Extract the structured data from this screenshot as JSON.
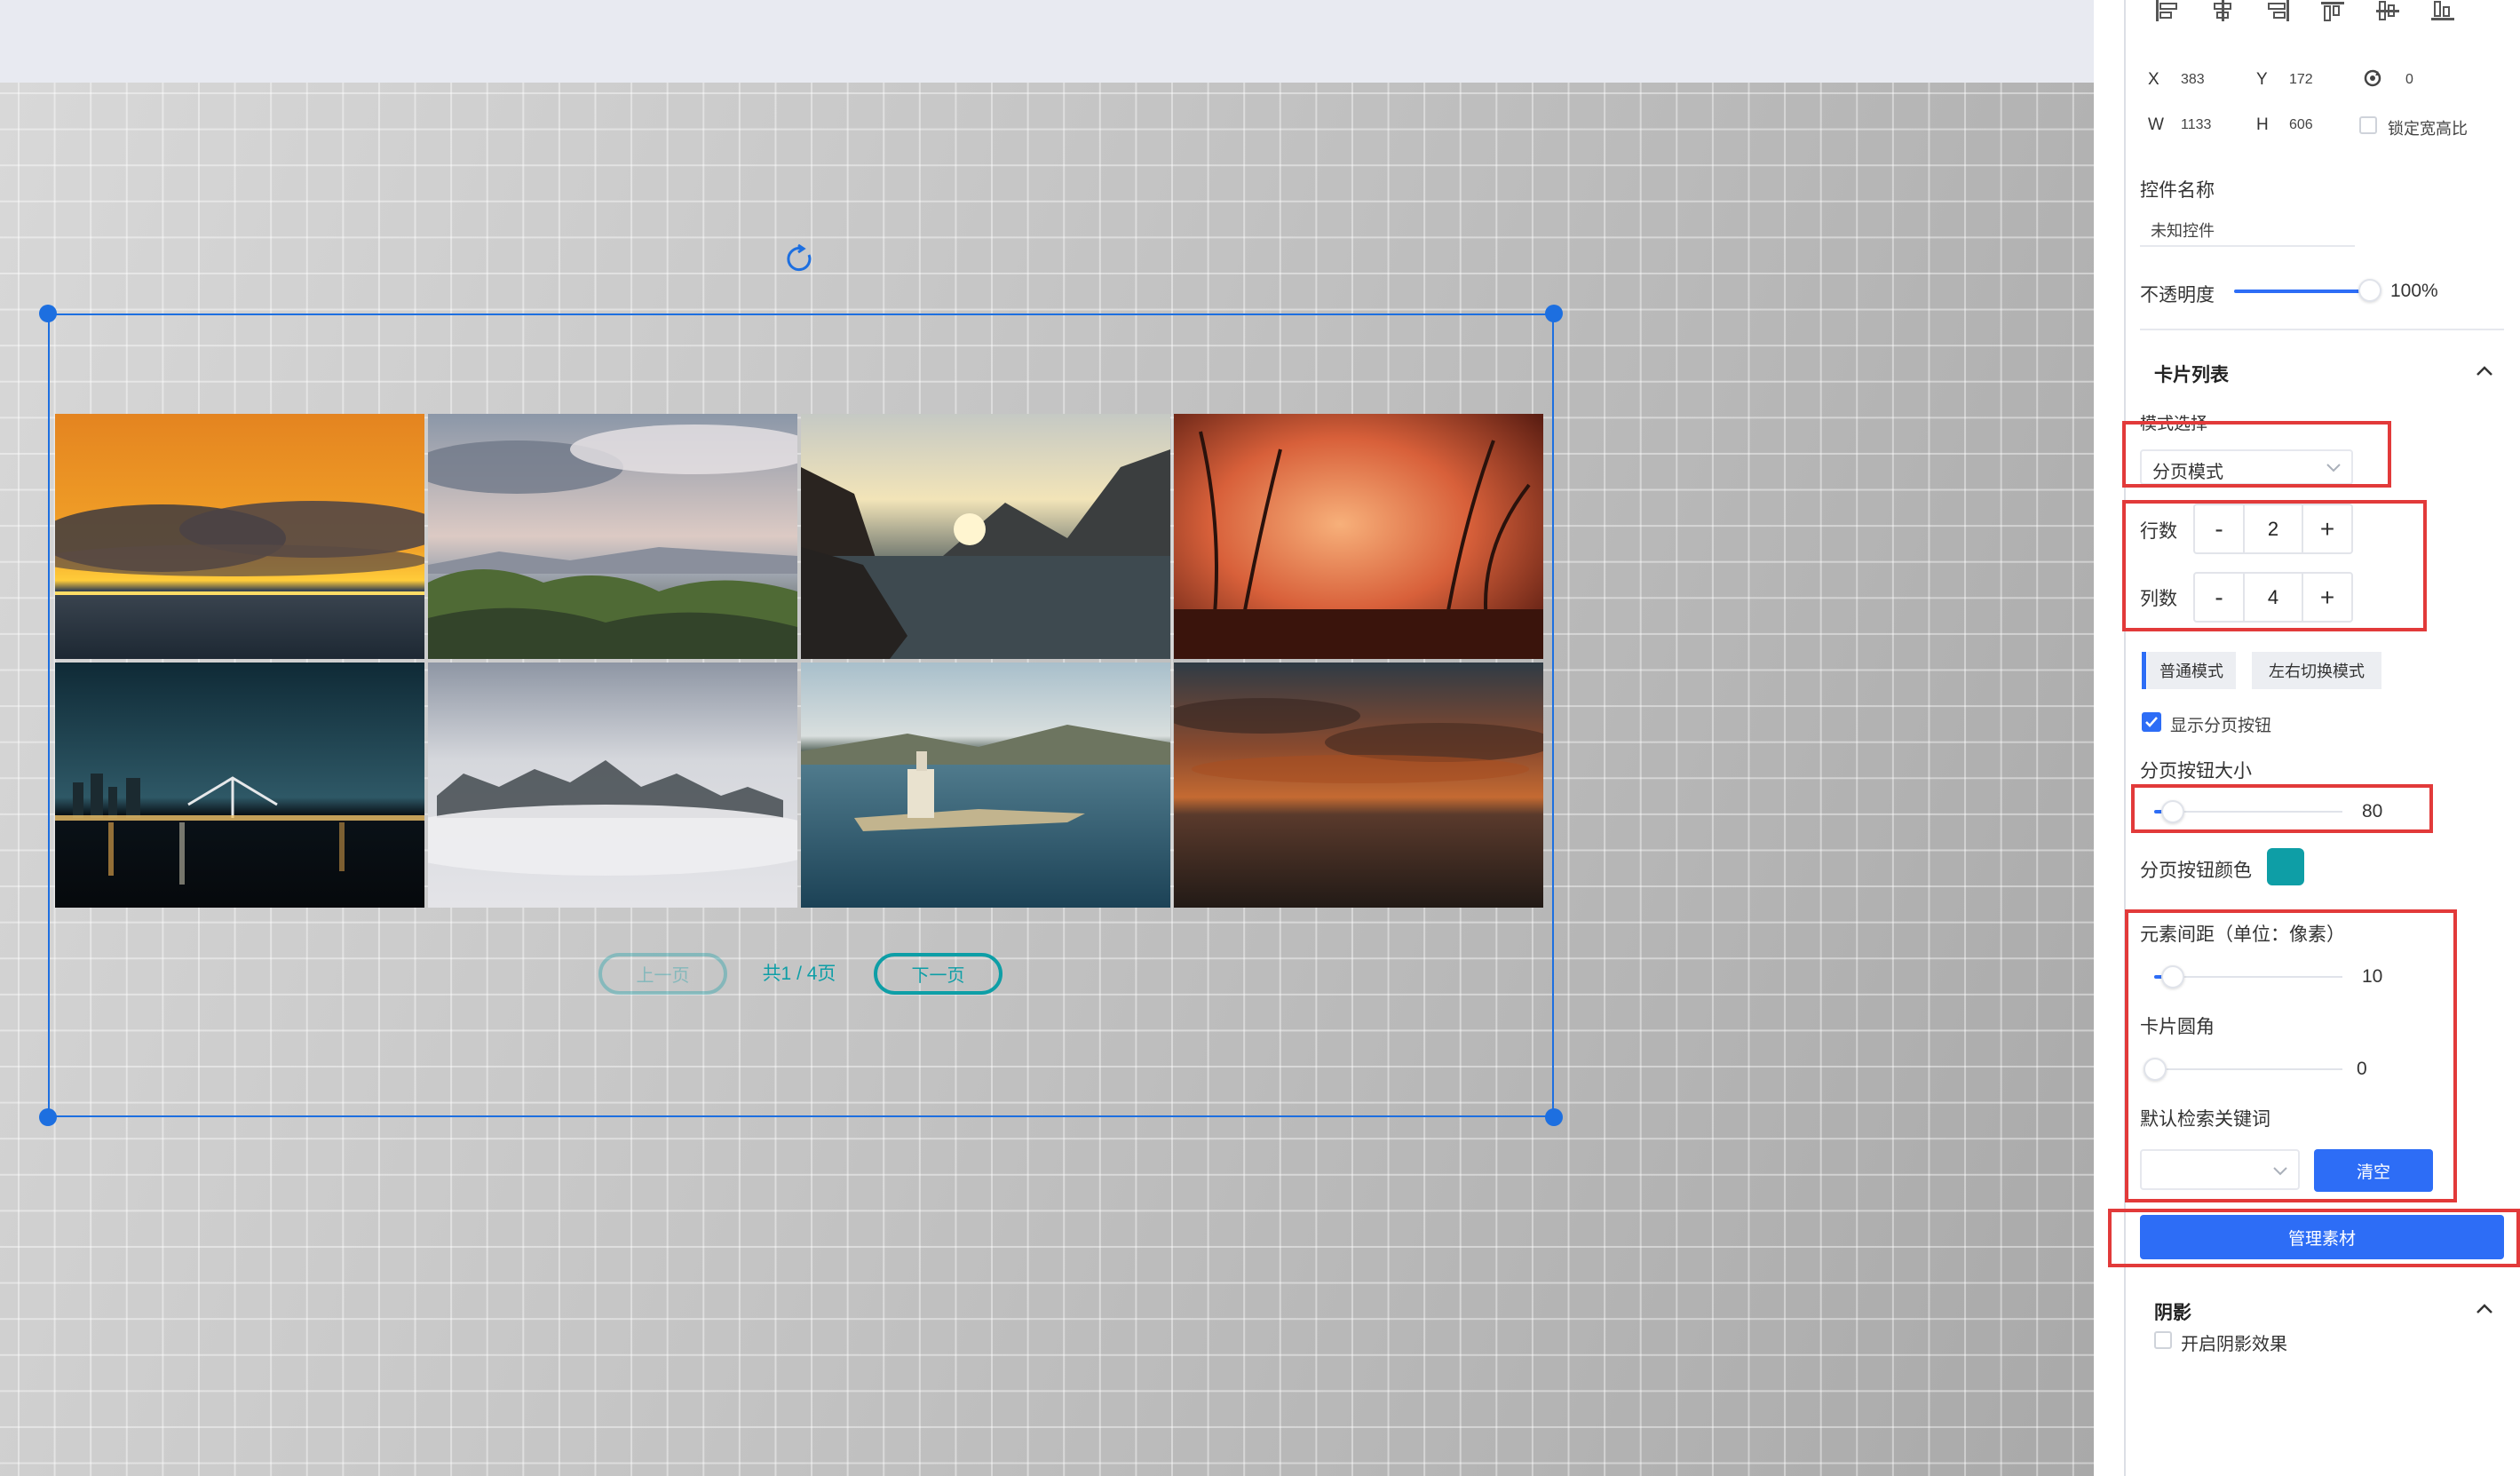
{
  "canvas": {
    "photos": [
      {
        "name": "sunset-clouds-sea"
      },
      {
        "name": "dunes-mountains"
      },
      {
        "name": "lake-mountains"
      },
      {
        "name": "grass-silhouette"
      },
      {
        "name": "city-night-bridge"
      },
      {
        "name": "misty-forest"
      },
      {
        "name": "lighthouse-island"
      },
      {
        "name": "cloudy-sea-dusk"
      }
    ],
    "pagination": {
      "prev_label": "上一页",
      "info": "共1 / 4页",
      "next_label": "下一页"
    }
  },
  "panel": {
    "position": {
      "x_label": "X",
      "x_value": "383",
      "y_label": "Y",
      "y_value": "172",
      "rotate_value": "0",
      "w_label": "W",
      "w_value": "1133",
      "h_label": "H",
      "h_value": "606",
      "lock_ratio_label": "锁定宽高比"
    },
    "control_name_label": "控件名称",
    "control_name_value": "未知控件",
    "opacity_label": "不透明度",
    "opacity_value": "100%",
    "opacity_fraction": 1.0,
    "card_list": {
      "title": "卡片列表",
      "mode_select_label": "模式选择",
      "mode_select_value": "分页模式",
      "rows_label": "行数",
      "rows_value": "2",
      "cols_label": "列数",
      "cols_value": "4",
      "minus": "-",
      "plus": "+",
      "mode_tabs": [
        "普通模式",
        "左右切换模式"
      ],
      "show_page_btn_label": "显示分页按钮",
      "show_page_btn_checked": true,
      "page_btn_size_label": "分页按钮大小",
      "page_btn_size_value": "80",
      "page_btn_color_label": "分页按钮颜色",
      "page_btn_color": "#0e9ea6",
      "spacing_label": "元素间距（单位：像素）",
      "spacing_value": "10",
      "radius_label": "卡片圆角",
      "radius_value": "0",
      "default_keyword_label": "默认检索关键词",
      "clear_label": "清空",
      "manage_label": "管理素材"
    },
    "shadow": {
      "title": "阴影",
      "enable_label": "开启阴影效果",
      "enabled": false
    }
  },
  "colors": {
    "accent": "#2d6df6",
    "selection": "#1d6fe0",
    "highlight_box": "#e23a3a",
    "teal": "#0e9ea6"
  }
}
